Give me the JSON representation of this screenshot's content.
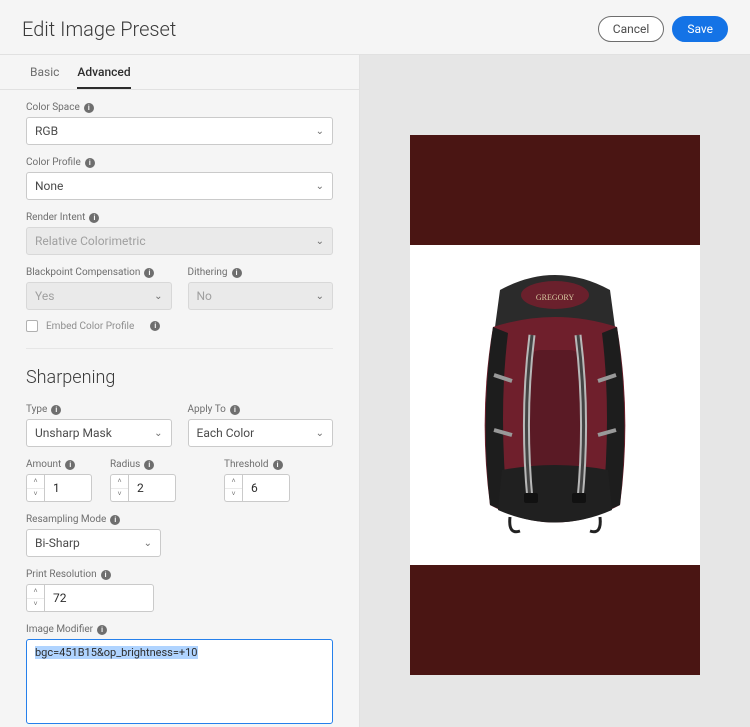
{
  "header": {
    "title": "Edit Image Preset",
    "cancel": "Cancel",
    "save": "Save"
  },
  "tabs": {
    "basic": "Basic",
    "advanced": "Advanced"
  },
  "color": {
    "space_label": "Color Space",
    "space_value": "RGB",
    "profile_label": "Color Profile",
    "profile_value": "None",
    "render_intent_label": "Render Intent",
    "render_intent_value": "Relative Colorimetric",
    "blackpoint_label": "Blackpoint Compensation",
    "blackpoint_value": "Yes",
    "dithering_label": "Dithering",
    "dithering_value": "No",
    "embed_profile_label": "Embed Color Profile"
  },
  "sharpening": {
    "section_title": "Sharpening",
    "type_label": "Type",
    "type_value": "Unsharp Mask",
    "applyto_label": "Apply To",
    "applyto_value": "Each Color",
    "amount_label": "Amount",
    "amount_value": "1",
    "radius_label": "Radius",
    "radius_value": "2",
    "threshold_label": "Threshold",
    "threshold_value": "6",
    "resampling_label": "Resampling Mode",
    "resampling_value": "Bi-Sharp",
    "print_res_label": "Print Resolution",
    "print_res_value": "72",
    "modifier_label": "Image Modifier",
    "modifier_value": "bgc=451B15&op_brightness=+10"
  },
  "preview": {
    "bg_color": "#4a1513"
  }
}
